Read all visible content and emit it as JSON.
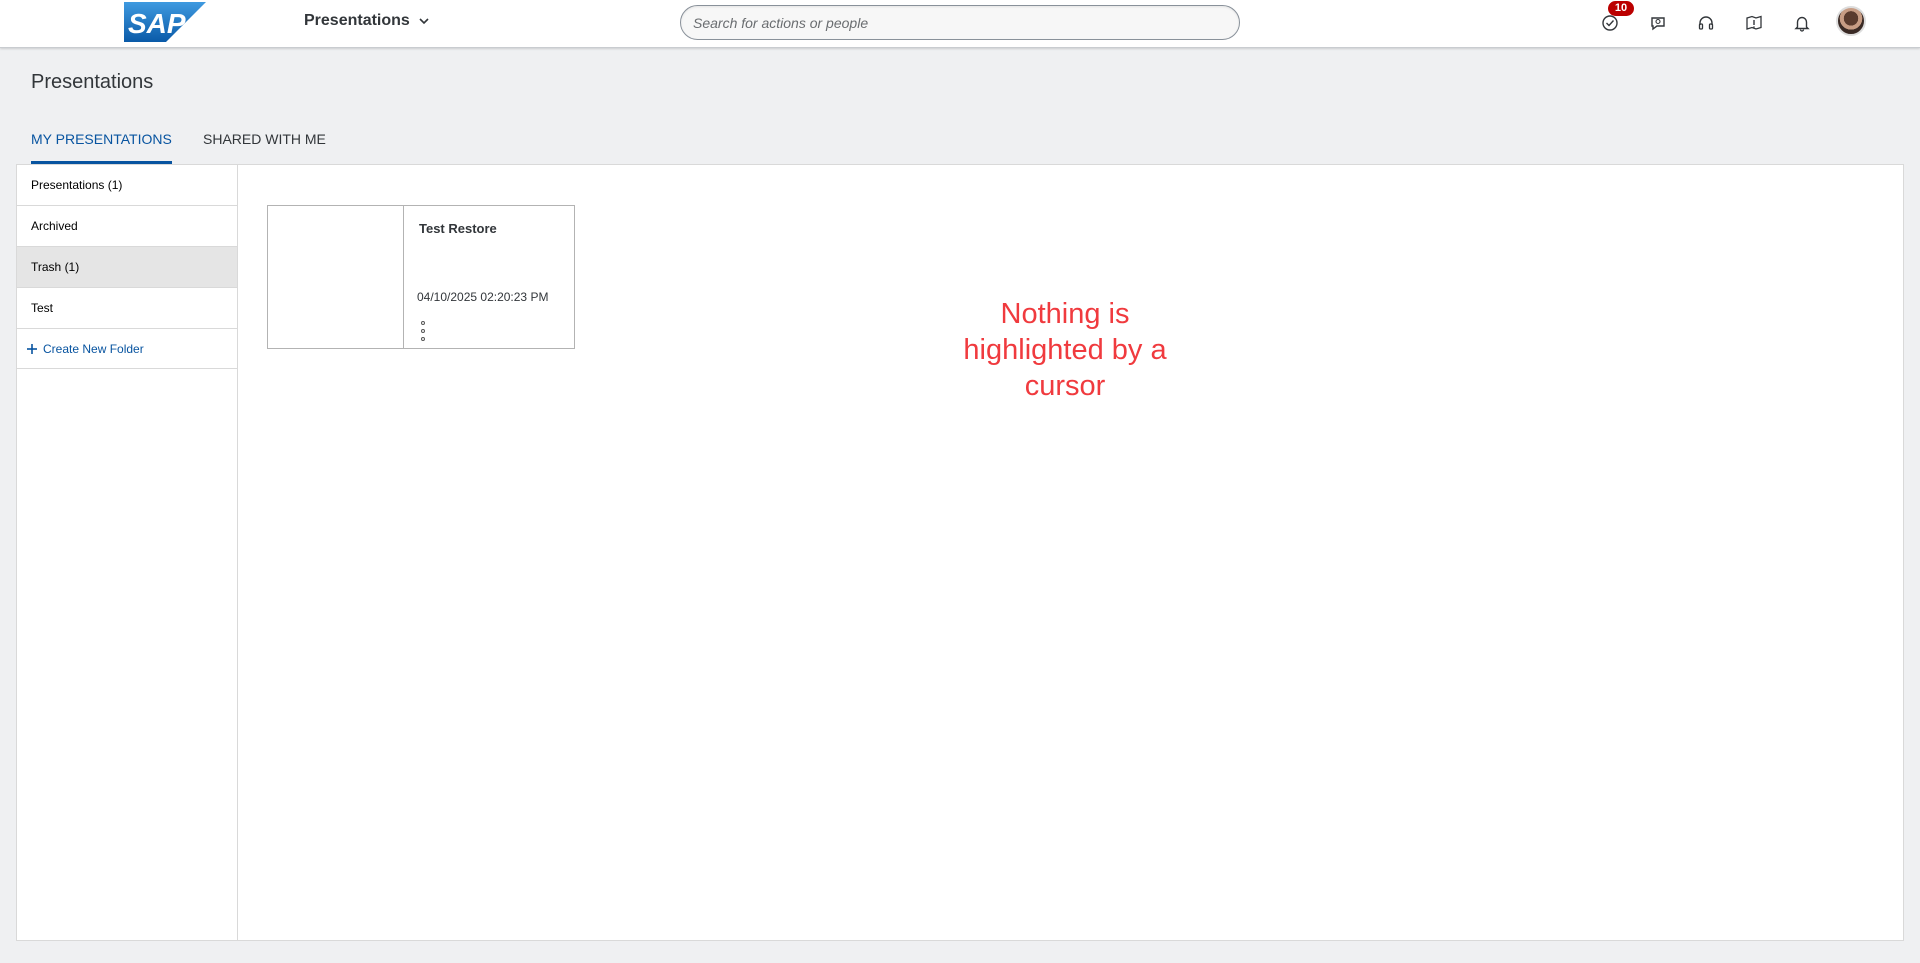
{
  "shell": {
    "logo_text": "SAP",
    "app_title": "Presentations",
    "search_placeholder": "Search for actions or people",
    "notification_count": "10",
    "icons": [
      "task-check-icon",
      "chat-icon",
      "headset-icon",
      "guide-icon",
      "bell-icon"
    ]
  },
  "page": {
    "title": "Presentations",
    "tabs": [
      {
        "label": "MY PRESENTATIONS",
        "active": true
      },
      {
        "label": "SHARED WITH ME",
        "active": false
      }
    ]
  },
  "sidebar": {
    "items": [
      {
        "label": "Presentations (1)"
      },
      {
        "label": "Archived"
      },
      {
        "label": "Trash (1)",
        "selected": true
      },
      {
        "label": "Test"
      }
    ],
    "create_label": "Create New Folder"
  },
  "cards": [
    {
      "title": "Test Restore",
      "date": "04/10/2025 02:20:23 PM"
    }
  ],
  "annotation": "Nothing is highlighted by a cursor",
  "colors": {
    "accent": "#0854a0",
    "badge": "#bb0000",
    "annotation": "#f03a3e",
    "logo": "#1b6fb8"
  }
}
